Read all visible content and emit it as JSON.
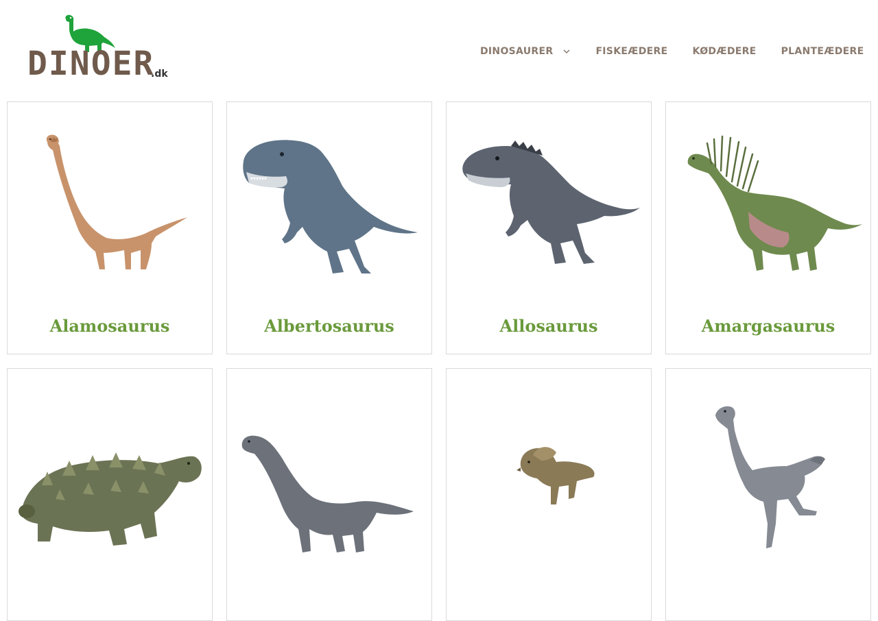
{
  "logo": {
    "text": "DINOER",
    "suffix": ".dk",
    "dino_color": "#1fa33b",
    "text_color": "#6f5a4c"
  },
  "nav": {
    "items": [
      {
        "label": "DINOSAURER",
        "has_dropdown": true
      },
      {
        "label": "FISKEÆDERE",
        "has_dropdown": false
      },
      {
        "label": "KØDÆDERE",
        "has_dropdown": false
      },
      {
        "label": "PLANTEÆDERE",
        "has_dropdown": false
      }
    ],
    "text_color": "#8a7a6e"
  },
  "cards": [
    {
      "title": "Alamosaurus",
      "image": "alamosaurus-image",
      "color": "#c8936b"
    },
    {
      "title": "Albertosaurus",
      "image": "albertosaurus-image",
      "color": "#5f7488"
    },
    {
      "title": "Allosaurus",
      "image": "allosaurus-image",
      "color": "#5d6470"
    },
    {
      "title": "Amargasaurus",
      "image": "amargasaurus-image",
      "color": "#6f8a4e"
    },
    {
      "title": "",
      "image": "ankylosaurus-image",
      "color": "#6b7355"
    },
    {
      "title": "",
      "image": "apatosaurus-image",
      "color": "#6c717a"
    },
    {
      "title": "",
      "image": "protoceratops-image",
      "color": "#8a7a56"
    },
    {
      "title": "",
      "image": "gallimimus-image",
      "color": "#858a93"
    }
  ],
  "title_color": "#6a9a3c"
}
